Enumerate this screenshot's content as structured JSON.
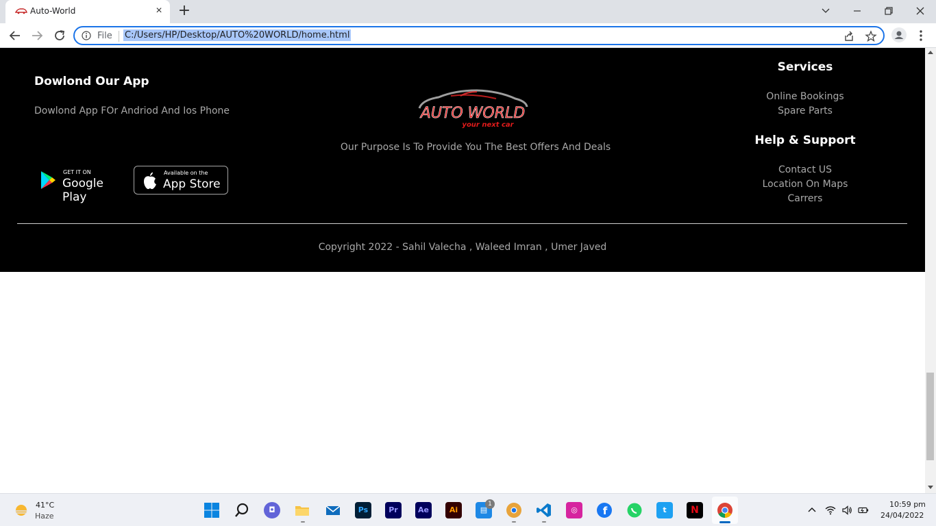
{
  "browser": {
    "tab_title": "Auto-World",
    "omnibox_scheme_label": "File",
    "url": "C:/Users/HP/Desktop/AUTO%20WORLD/home.html"
  },
  "footer": {
    "app_section": {
      "heading": "Dowlond Our App",
      "description": "Dowlond App FOr Andriod And Ios Phone",
      "google_play_small": "GET IT ON",
      "google_play_big": "Google Play",
      "app_store_small": "Available on the",
      "app_store_big": "App Store"
    },
    "logo": {
      "brand_text": "AUTO WORLD",
      "tagline": "your next car"
    },
    "purpose": "Our Purpose Is To Provide You The Best Offers And Deals",
    "services": {
      "heading": "Services",
      "links": [
        "Online Bookings",
        "Spare Parts"
      ]
    },
    "help": {
      "heading": "Help & Support",
      "links": [
        "Contact US",
        "Location On Maps",
        "Carrers"
      ]
    },
    "copyright": "Copyright 2022 - Sahil Valecha , Waleed Imran , Umer Javed"
  },
  "taskbar": {
    "weather_temp": "41°C",
    "weather_desc": "Haze",
    "apps": [
      "start-icon",
      "search-icon",
      "chat-icon",
      "file-explorer-icon",
      "mail-icon",
      "photoshop-icon",
      "premiere-icon",
      "after-effects-icon",
      "illustrator-icon",
      "notes-icon",
      "chrome-canary-icon",
      "vscode-icon",
      "instagram-icon",
      "facebook-icon",
      "whatsapp-icon",
      "twitter-icon",
      "netflix-icon",
      "chrome-icon"
    ],
    "notes_badge": "1",
    "time": "10:59 pm",
    "date": "24/04/2022"
  }
}
